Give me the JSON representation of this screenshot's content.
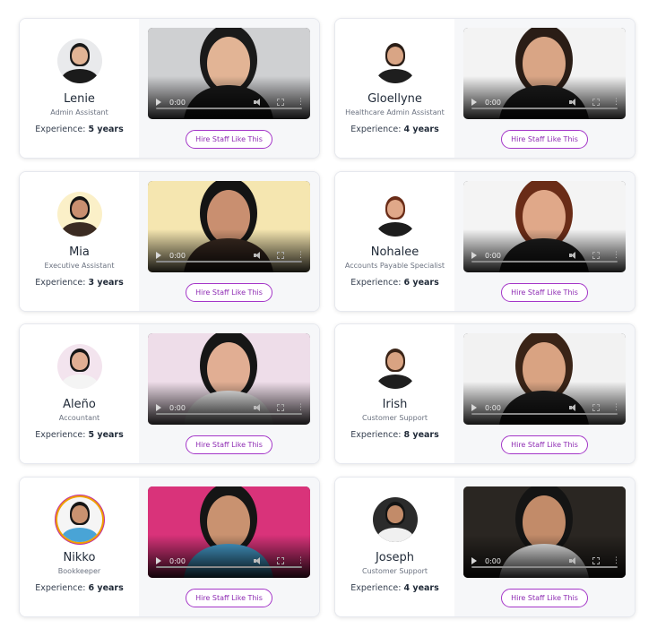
{
  "cards": [
    {
      "name": "Lenie",
      "role": "Admin Assistant",
      "exp_label": "Experience:",
      "exp_value": "5 years",
      "hire": "Hire Staff Like This",
      "time": "0:00",
      "avatar_icon": "person-avatar",
      "skin": "#e2b495",
      "hair": "#1a1a1a",
      "top": "#1b1b1b",
      "bg": "#e9eaec",
      "scene": "#cfd0d2"
    },
    {
      "name": "Gloellyne",
      "role": "Healthcare Admin Assistant",
      "exp_label": "Experience:",
      "exp_value": "4 years",
      "hire": "Hire Staff Like This",
      "time": "0:00",
      "avatar_icon": "person-avatar",
      "skin": "#d9a585",
      "hair": "#2a1d16",
      "top": "#1e1e1e",
      "bg": "#ffffff",
      "scene": "#f3f3f3"
    },
    {
      "name": "Mia",
      "role": "Executive Assistant",
      "exp_label": "Experience:",
      "exp_value": "3 years",
      "hire": "Hire Staff Like This",
      "time": "0:00",
      "avatar_icon": "person-avatar",
      "skin": "#c98f70",
      "hair": "#141414",
      "top": "#3b2b22",
      "bg": "#fbf0c8",
      "scene": "#f5e6b0"
    },
    {
      "name": "Nohalee",
      "role": "Accounts Payable Specialist",
      "exp_label": "Experience:",
      "exp_value": "6 years",
      "hire": "Hire Staff Like This",
      "time": "0:00",
      "avatar_icon": "person-avatar",
      "skin": "#e0a889",
      "hair": "#6a2c17",
      "top": "#1d1d1d",
      "bg": "#ffffff",
      "scene": "#f4f4f4"
    },
    {
      "name": "Aleño",
      "role": "Accountant",
      "exp_label": "Experience:",
      "exp_value": "5 years",
      "hire": "Hire Staff Like This",
      "time": "0:00",
      "avatar_icon": "person-avatar",
      "skin": "#e1ae93",
      "hair": "#161616",
      "top": "#f4f4f4",
      "bg": "#f3e4ee",
      "scene": "#eedde9"
    },
    {
      "name": "Irish",
      "role": "Customer Support",
      "exp_label": "Experience:",
      "exp_value": "8 years",
      "hire": "Hire Staff Like This",
      "time": "0:00",
      "avatar_icon": "person-avatar",
      "skin": "#d9a382",
      "hair": "#3a2417",
      "top": "#1f1f1f",
      "bg": "#ffffff",
      "scene": "#f2f2f2"
    },
    {
      "name": "Nikko",
      "role": "Bookkeeper",
      "exp_label": "Experience:",
      "exp_value": "6 years",
      "hire": "Hire Staff Like This",
      "time": "0:00",
      "avatar_icon": "person-avatar",
      "skin": "#c99270",
      "hair": "#151515",
      "top": "#49a4d6",
      "bg": "#f5f5f5",
      "scene": "#d9337a"
    },
    {
      "name": "Joseph",
      "role": "Customer Support",
      "exp_label": "Experience:",
      "exp_value": "4 years",
      "hire": "Hire Staff Like This",
      "time": "0:00",
      "avatar_icon": "person-avatar",
      "skin": "#c28b69",
      "hair": "#141414",
      "top": "#f0f0f0",
      "bg": "#2b2b2b",
      "scene": "#2a2622"
    }
  ]
}
